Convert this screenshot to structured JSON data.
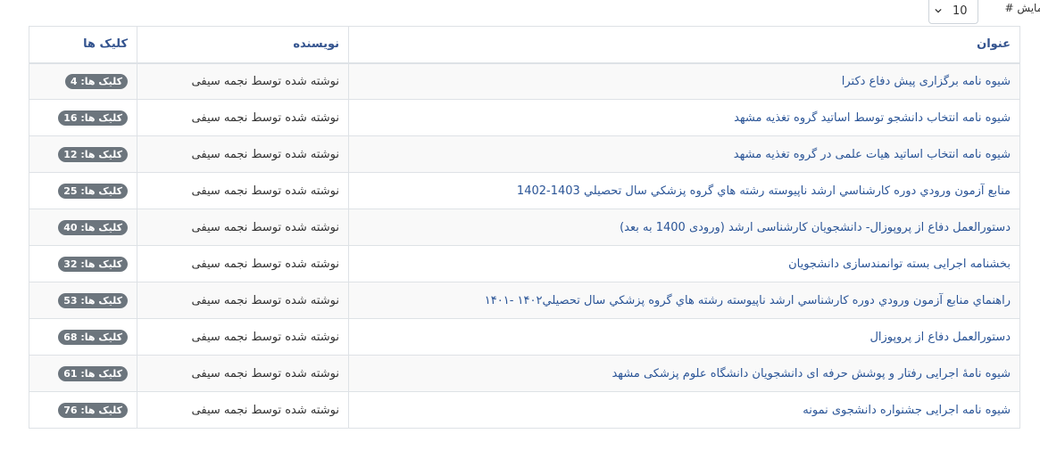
{
  "limit": {
    "label": "نمایش #",
    "value": "10"
  },
  "table": {
    "headers": {
      "title": "عنوان",
      "author": "نویسنده",
      "hits": "کلیک ها"
    },
    "rows": [
      {
        "title": "شیوه نامه برگزاری پیش دفاع دکترا",
        "author": "نوشته شده توسط نجمه سیفی",
        "hits": "کلیک ها: 4"
      },
      {
        "title": "شیوه نامه انتخاب دانشجو توسط اساتید گروه تغذیه مشهد",
        "author": "نوشته شده توسط نجمه سیفی",
        "hits": "کلیک ها: 16"
      },
      {
        "title": "شیوه نامه انتخاب اساتید هیات علمی در گروه تغذیه مشهد",
        "author": "نوشته شده توسط نجمه سیفی",
        "hits": "کلیک ها: 12"
      },
      {
        "title": "منابع آزمون ورودي دوره كارشناسي ارشد ناپيوسته رشته هاي گروه پزشكي سال تحصيلي 1403-1402",
        "author": "نوشته شده توسط نجمه سیفی",
        "hits": "کلیک ها: 25"
      },
      {
        "title": "دستورالعمل دفاع از پروپوزال- دانشجویان کارشناسی ارشد (ورودی 1400 به بعد)",
        "author": "نوشته شده توسط نجمه سیفی",
        "hits": "کلیک ها: 40"
      },
      {
        "title": "بخشنامه اجرایی بسته توانمندسازی دانشجویان",
        "author": "نوشته شده توسط نجمه سیفی",
        "hits": "کلیک ها: 32"
      },
      {
        "title": "راهنماي منابع آزمون ورودي دوره كارشناسي ارشد ناپيوسته رشته هاي گروه پزشكي سال تحصيلي۱۴۰۲ -۱۴۰۱",
        "author": "نوشته شده توسط نجمه سیفی",
        "hits": "کلیک ها: 53"
      },
      {
        "title": "دستورالعمل دفاع از پروپوزال",
        "author": "نوشته شده توسط نجمه سیفی",
        "hits": "کلیک ها: 68"
      },
      {
        "title": "شیوه نامۀ اجرایی رفتار و پوشش حرفه ای دانشجویان دانشگاه علوم پزشکی مشهد",
        "author": "نوشته شده توسط نجمه سیفی",
        "hits": "کلیک ها: 61"
      },
      {
        "title": "شیوه نامه اجرایی جشنواره دانشجوی نمونه",
        "author": "نوشته شده توسط نجمه سیفی",
        "hits": "کلیک ها: 76"
      }
    ]
  }
}
